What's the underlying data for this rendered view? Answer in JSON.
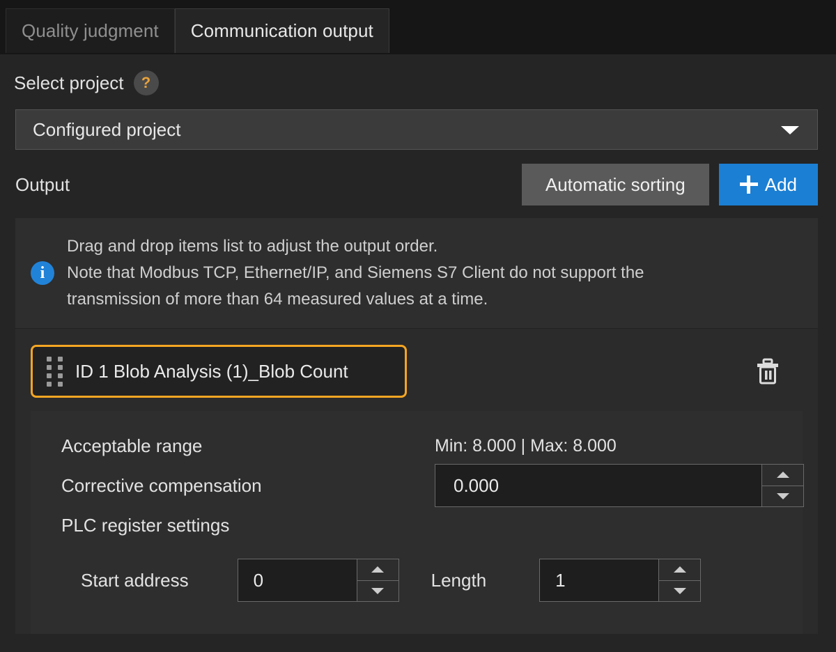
{
  "tabs": [
    {
      "label": "Quality judgment",
      "active": false
    },
    {
      "label": "Communication output",
      "active": true
    }
  ],
  "select_project": {
    "label": "Select project",
    "help_icon": "question-mark-icon",
    "help_glyph": "?",
    "dropdown_value": "Configured project",
    "dropdown_icon": "chevron-down-icon"
  },
  "output": {
    "label": "Output",
    "auto_sort_label": "Automatic sorting",
    "add_label": "Add",
    "add_icon": "plus-icon"
  },
  "note": {
    "icon": "info-icon",
    "icon_glyph": "i",
    "line1": "Drag and drop items list to adjust the output order.",
    "line2": "Note that Modbus TCP, Ethernet/IP, and Siemens S7 Client do not support the",
    "line3": "transmission of more than 64 measured values at a time."
  },
  "item": {
    "drag_icon": "drag-handle-icon",
    "label": "ID 1  Blob Analysis (1)_Blob Count",
    "delete_icon": "trash-icon"
  },
  "details": {
    "acceptable_range_label": "Acceptable range",
    "acceptable_range_value": "Min: 8.000 | Max: 8.000",
    "corrective_compensation_label": "Corrective compensation",
    "corrective_compensation_value": "0.000",
    "plc_register_label": "PLC register settings",
    "start_address_label": "Start address",
    "start_address_value": "0",
    "length_label": "Length",
    "length_value": "1",
    "spinner_up_icon": "triangle-up-icon",
    "spinner_down_icon": "triangle-down-icon"
  },
  "colors": {
    "accent_blue": "#1b7fd4",
    "highlight_orange": "#f5a623",
    "help_amber": "#e8a33d",
    "info_blue": "#2183d8",
    "window_bg": "#252525",
    "tabbar_bg": "#161616",
    "panel_bg": "#2e2e2e"
  }
}
